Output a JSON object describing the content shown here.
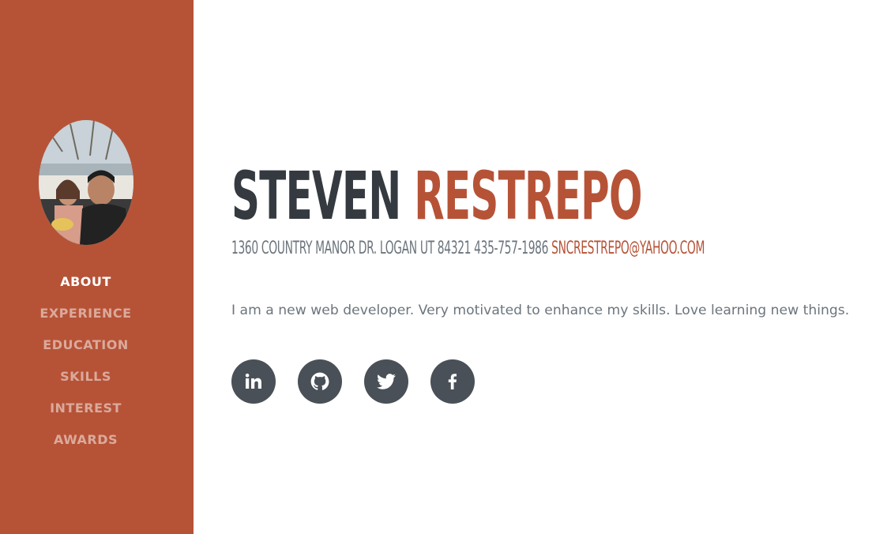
{
  "sidebar": {
    "avatar_alt": "profile photo",
    "nav": [
      {
        "label": "ABOUT",
        "active": true
      },
      {
        "label": "EXPERIENCE",
        "active": false
      },
      {
        "label": "EDUCATION",
        "active": false
      },
      {
        "label": "SKILLS",
        "active": false
      },
      {
        "label": "INTEREST",
        "active": false
      },
      {
        "label": "AWARDS",
        "active": false
      }
    ]
  },
  "header": {
    "first_name": "STEVEN",
    "last_name": "RESTREPO"
  },
  "contact": {
    "address_phone": "1360 COUNTRY MANOR DR. LOGAN UT 84321 435-757-1986",
    "email": "SNCRESTREPO@YAHOO.COM"
  },
  "intro": "I am a new web developer. Very motivated to enhance my skills. Love learning new things.",
  "social": [
    {
      "icon": "linkedin-icon"
    },
    {
      "icon": "github-icon"
    },
    {
      "icon": "twitter-icon"
    },
    {
      "icon": "facebook-icon"
    }
  ],
  "colors": {
    "accent": "#b65337",
    "dark": "#343a40",
    "muted": "#6c757d",
    "icon_bg": "#495057"
  }
}
